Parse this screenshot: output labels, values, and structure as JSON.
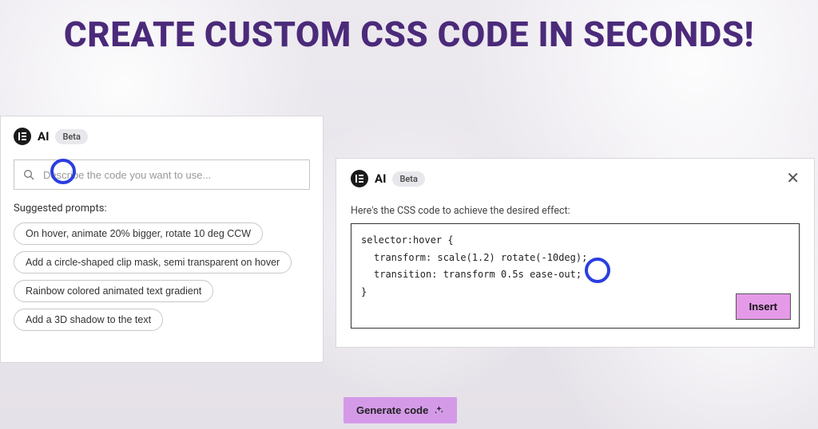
{
  "headline": "CREATE CUSTOM CSS CODE IN SECONDS!",
  "left": {
    "ai_label": "AI",
    "beta_label": "Beta",
    "search_placeholder": "Describe the code you want to use...",
    "suggested_label": "Suggested prompts:",
    "prompts": [
      "On hover, animate 20% bigger, rotate 10 deg CCW",
      "Add a circle-shaped clip mask, semi transparent on hover",
      "Rainbow colored animated text gradient",
      "Add a 3D shadow to the text"
    ]
  },
  "right": {
    "ai_label": "AI",
    "beta_label": "Beta",
    "result_label": "Here's the CSS code to achieve the desired effect:",
    "code": [
      "selector:hover {",
      "transform: scale(1.2) rotate(-10deg);",
      "transition: transform 0.5s ease-out;",
      "}"
    ],
    "insert_label": "Insert"
  },
  "generate_label": "Generate code"
}
